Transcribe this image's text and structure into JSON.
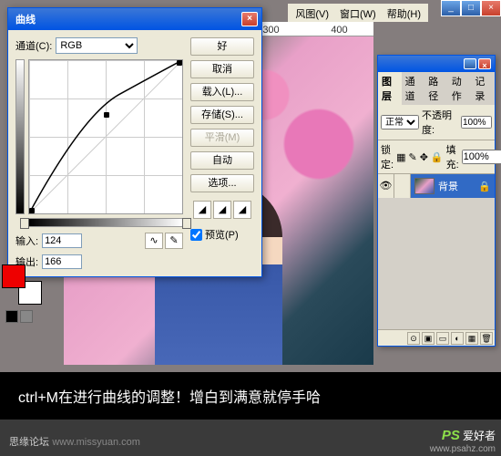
{
  "main_menu": {
    "view": "风图(V)",
    "window": "窗口(W)",
    "help": "帮助(H)"
  },
  "ruler": {
    "t1": "300",
    "t2": "400"
  },
  "curves": {
    "title": "曲线",
    "channel_label": "通道(C):",
    "channel_value": "RGB",
    "input_label": "输入:",
    "input_value": "124",
    "output_label": "输出:",
    "output_value": "166",
    "buttons": {
      "ok": "好",
      "cancel": "取消",
      "load": "载入(L)...",
      "save": "存储(S)...",
      "smooth": "平滑(M)",
      "auto": "自动",
      "options": "选项..."
    },
    "preview_label": "预览(P)",
    "tool_curve": "∿",
    "tool_pencil": "✎"
  },
  "layers": {
    "tabs": {
      "layers": "图层",
      "channels": "通道",
      "paths": "路径",
      "actions": "动作",
      "history": "记录"
    },
    "blend_mode": "正常",
    "opacity_label": "不透明度:",
    "opacity_value": "100%",
    "lock_label": "锁定:",
    "fill_label": "填充:",
    "fill_value": "100%",
    "layer_name": "背景",
    "eye": "👁",
    "icons": {
      "lock_trans": "▦",
      "lock_paint": "✎",
      "lock_move": "✥",
      "lock_all": "🔒"
    },
    "bottom": {
      "fx": "⊙",
      "mask": "▣",
      "folder": "▭",
      "adjust": "◐",
      "new": "▦",
      "trash": "🗑"
    }
  },
  "caption": "ctrl+M在进行曲线的调整！增白到满意就停手哈",
  "footer": {
    "left": "思缘论坛",
    "left_url": "www.missyuan.com",
    "brand": "PS",
    "brand2": "爱好者",
    "url": "www.psahz.com"
  },
  "winbtns": {
    "min": "_",
    "max": "□",
    "close": "×"
  }
}
